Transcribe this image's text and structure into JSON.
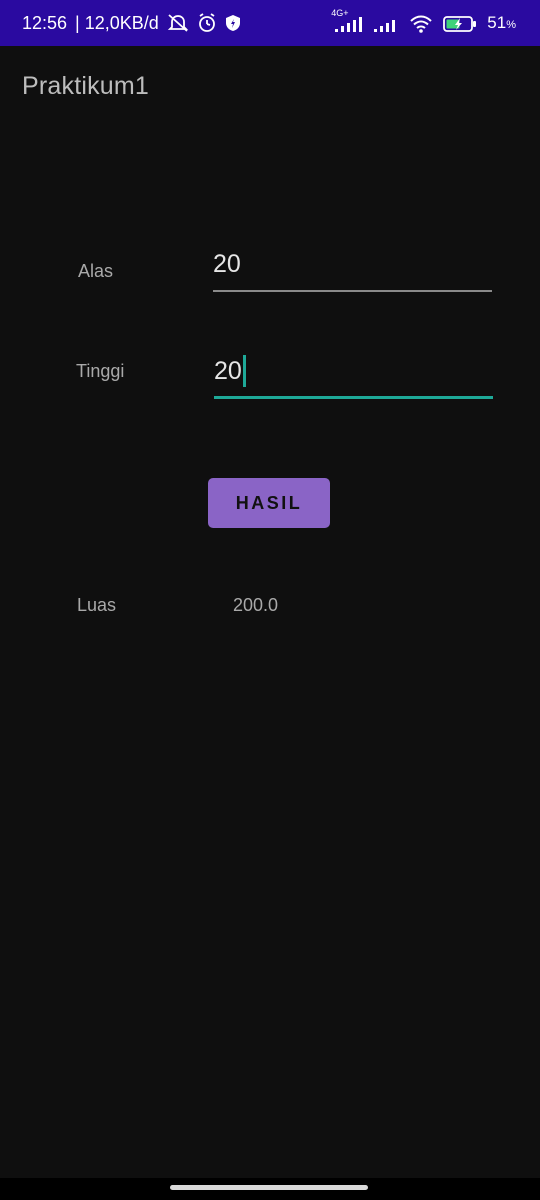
{
  "status_bar": {
    "time": "12:56",
    "speed": "| 12,0KB/d",
    "network_label": "4G+",
    "battery_percent": "51",
    "battery_unit": "%",
    "icons": [
      "mute-icon",
      "alarm-icon",
      "shield-icon",
      "cellular-signal-icon",
      "wifi-icon",
      "battery-icon"
    ],
    "background_color": "#2a0aa0"
  },
  "app_bar": {
    "title": "Praktikum1"
  },
  "form": {
    "alas_label": "Alas",
    "alas_value": "20",
    "tinggi_label": "Tinggi",
    "tinggi_value": "20",
    "hasil_button": "HASIL",
    "luas_label": "Luas",
    "luas_value": "200.0"
  },
  "colors": {
    "background": "#0f0f0f",
    "accent": "#1ea998",
    "button": "#8a64c6"
  }
}
